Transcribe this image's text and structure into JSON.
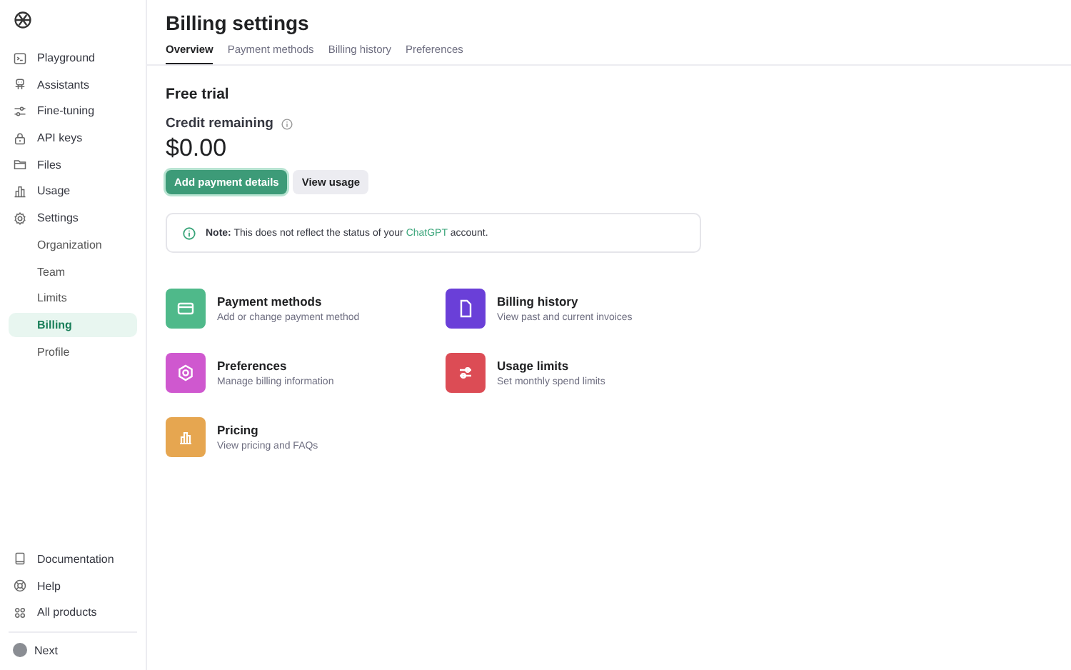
{
  "sidebar": {
    "items": [
      {
        "label": "Playground",
        "kind": "main",
        "selected": false
      },
      {
        "label": "Assistants",
        "kind": "main",
        "selected": false
      },
      {
        "label": "Fine-tuning",
        "kind": "main",
        "selected": false
      },
      {
        "label": "API keys",
        "kind": "main",
        "selected": false
      },
      {
        "label": "Files",
        "kind": "main",
        "selected": false
      },
      {
        "label": "Usage",
        "kind": "main",
        "selected": false
      },
      {
        "label": "Settings",
        "kind": "main",
        "selected": false
      },
      {
        "label": "Organization",
        "kind": "sub",
        "selected": false
      },
      {
        "label": "Team",
        "kind": "sub",
        "selected": false
      },
      {
        "label": "Limits",
        "kind": "sub",
        "selected": false
      },
      {
        "label": "Billing",
        "kind": "sub",
        "selected": true
      },
      {
        "label": "Profile",
        "kind": "sub",
        "selected": false
      }
    ],
    "footer_items": [
      {
        "label": "Documentation"
      },
      {
        "label": "Help"
      },
      {
        "label": "All products"
      }
    ],
    "user": {
      "name": "Next"
    }
  },
  "page": {
    "title": "Billing settings",
    "tabs": [
      {
        "label": "Overview",
        "selected": true
      },
      {
        "label": "Payment methods",
        "selected": false
      },
      {
        "label": "Billing history",
        "selected": false
      },
      {
        "label": "Preferences",
        "selected": false
      }
    ],
    "plan": "Free trial",
    "credit_label": "Credit remaining",
    "credit": "$0.00",
    "buttons": [
      {
        "label": "Add payment details",
        "kind": "primary"
      },
      {
        "label": "View usage",
        "kind": "secondary"
      }
    ],
    "note": {
      "label": "Note:",
      "before": "This does not reflect the status of your",
      "link": "ChatGPT",
      "after": "account."
    },
    "cards": [
      {
        "title": "Payment methods",
        "description": "Add or change payment method",
        "color": "#4fb98a"
      },
      {
        "title": "Billing history",
        "description": "View past and current invoices",
        "color": "#6a3fd8"
      },
      {
        "title": "Preferences",
        "description": "Manage billing information",
        "color": "#cf58cf"
      },
      {
        "title": "Usage limits",
        "description": "Set monthly spend limits",
        "color": "#dc4c55"
      },
      {
        "title": "Pricing",
        "description": "View pricing and FAQs",
        "color": "#e6a650"
      }
    ]
  }
}
